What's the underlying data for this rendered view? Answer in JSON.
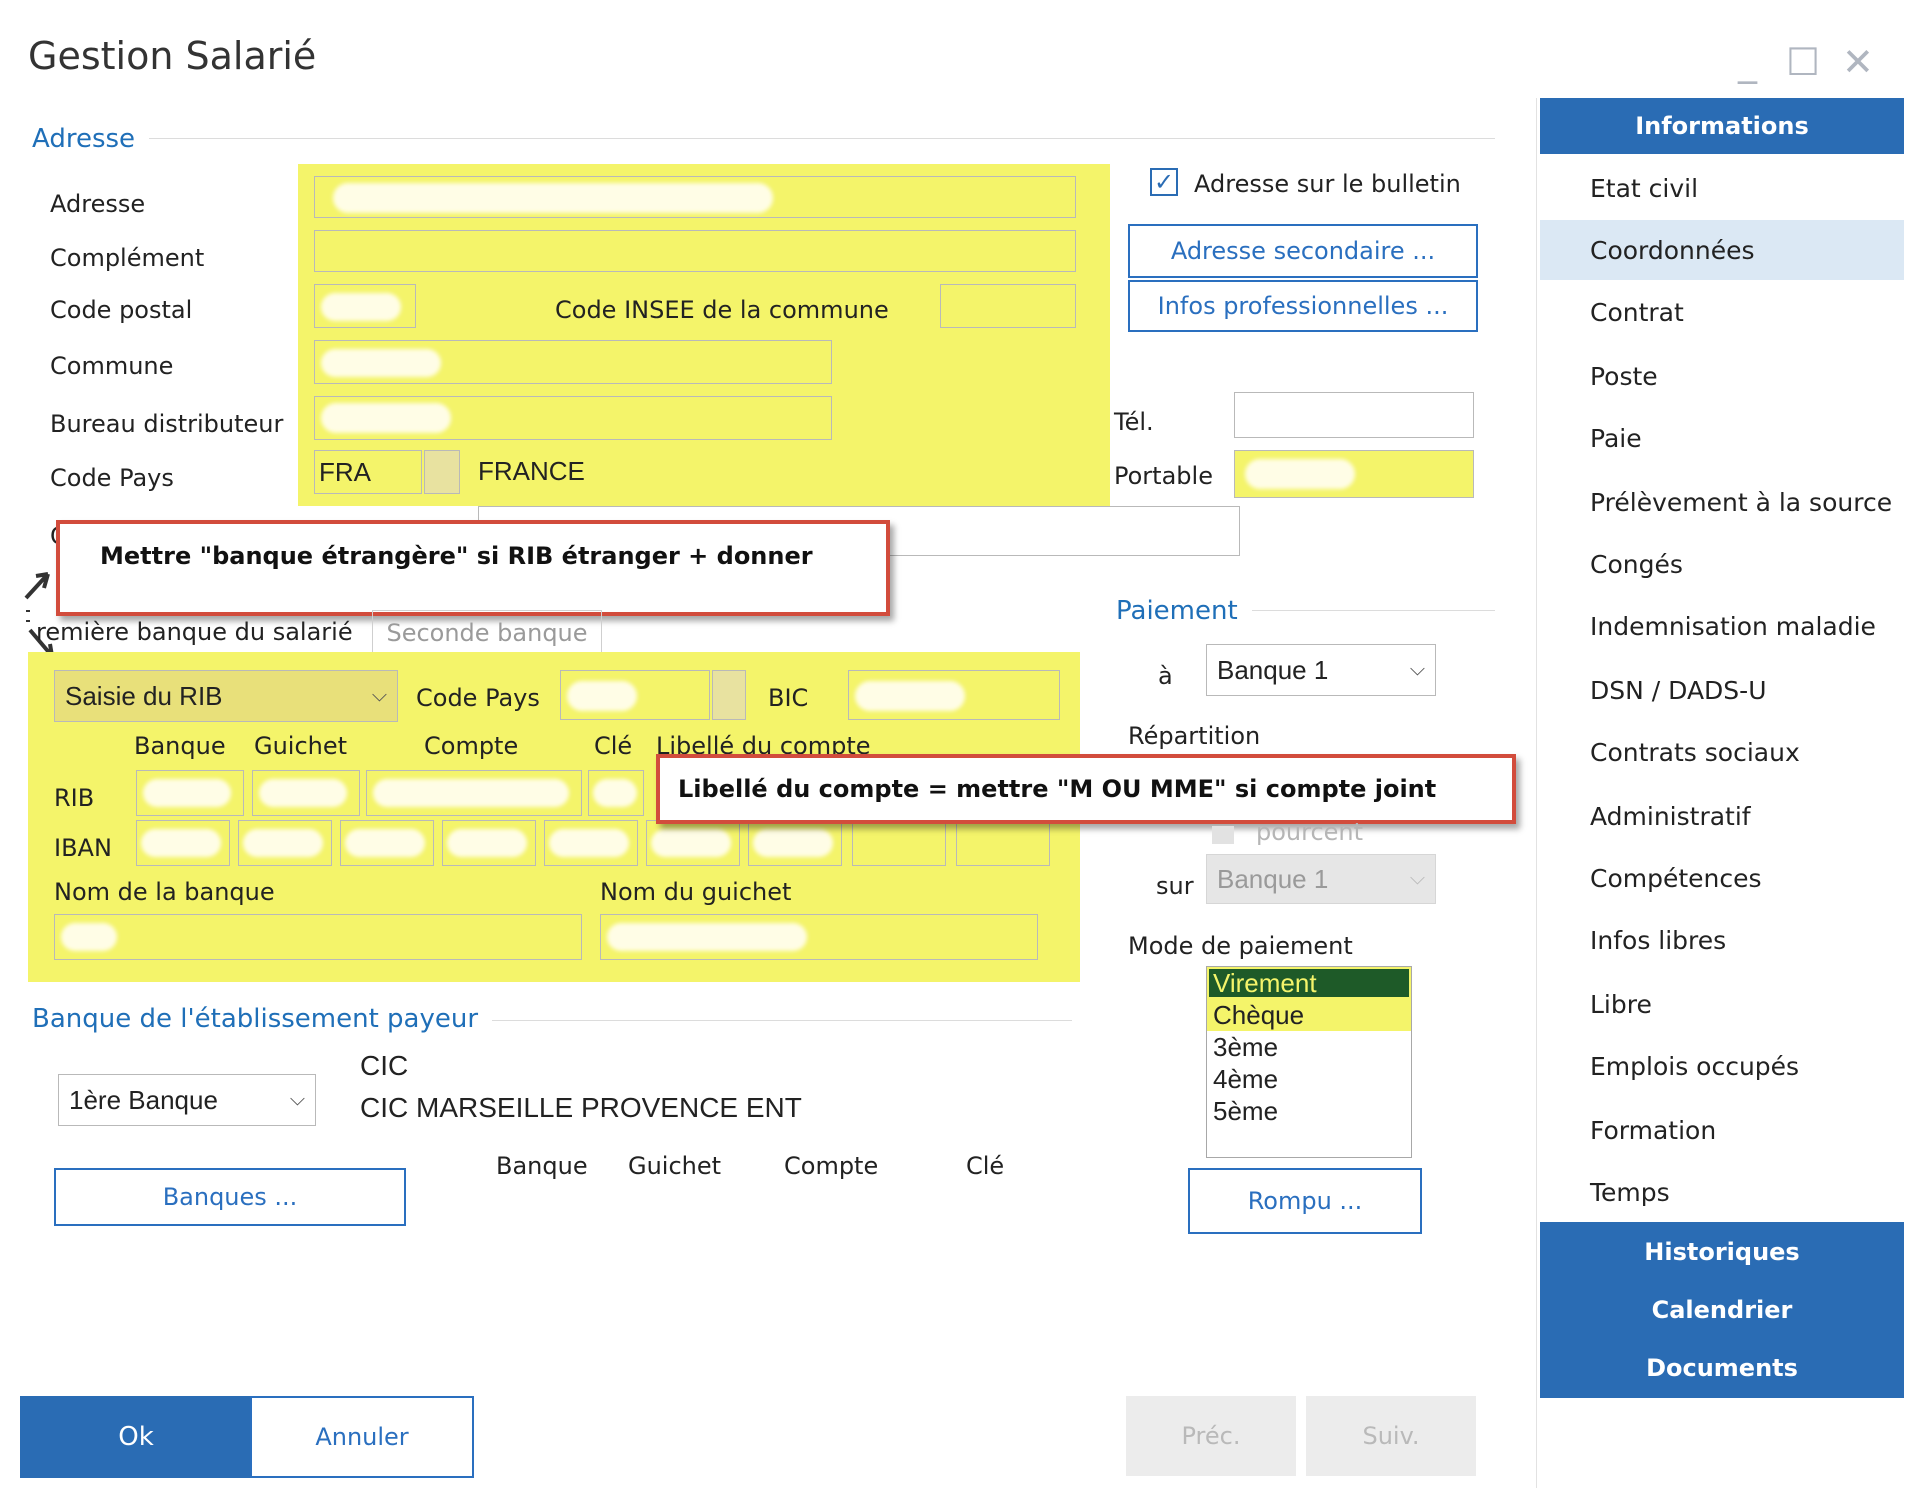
{
  "window": {
    "title": "Gestion Salarié",
    "controls": {
      "minimize": "_",
      "maximize": "☐",
      "close": "✕"
    }
  },
  "address_section": {
    "title": "Adresse",
    "labels": {
      "adresse": "Adresse",
      "complement": "Complément",
      "code_postal": "Code postal",
      "commune": "Commune",
      "bureau": "Bureau distributeur",
      "code_pays": "Code Pays",
      "insee": "Code INSEE de la commune"
    },
    "country_code": "FRA",
    "country_name": "FRANCE",
    "checkbox_label": "Adresse sur le bulletin",
    "checkbox_checked": true,
    "btn_secondary": "Adresse secondaire ...",
    "btn_pro": "Infos professionnelles ...",
    "tel_label": "Tél.",
    "portable_label": "Portable"
  },
  "notes": {
    "note1": "Mettre \"banque étrangère\" si RIB étranger + donner",
    "note2": "Libellé du compte = mettre \"M OU MME\" si compte joint"
  },
  "bank_section": {
    "tab1": "remière banque du salarié",
    "tab2": "Seconde banque",
    "saisie_select": "Saisie du RIB",
    "code_pays_label": "Code Pays",
    "bic_label": "BIC",
    "columns": {
      "banque": "Banque",
      "guichet": "Guichet",
      "compte": "Compte",
      "cle": "Clé",
      "libelle": "Libellé du compte"
    },
    "rib_label": "RIB",
    "iban_label": "IBAN",
    "nom_banque": "Nom de la banque",
    "nom_guichet": "Nom du guichet"
  },
  "payment_section": {
    "title": "Paiement",
    "a_label": "à",
    "a_value": "Banque 1",
    "repartition_label": "Répartition",
    "pourcent_label": "pourcent",
    "sur_label": "sur",
    "sur_value": "Banque 1",
    "mode_label": "Mode de paiement",
    "modes": [
      "Virement",
      "Chèque",
      "3ème",
      "4ème",
      "5ème"
    ],
    "rompu_button": "Rompu ..."
  },
  "payer_bank_section": {
    "title": "Banque de l'établissement payeur",
    "select_value": "1ère Banque",
    "bank_name": "CIC",
    "bank_branch": "CIC MARSEILLE PROVENCE ENT",
    "col_banque": "Banque",
    "col_guichet": "Guichet",
    "col_compte": "Compte",
    "col_cle": "Clé",
    "banques_button": "Banques ..."
  },
  "footer": {
    "ok": "Ok",
    "annuler": "Annuler",
    "prec": "Préc.",
    "suiv": "Suiv."
  },
  "sidebar": {
    "informations": "Informations",
    "items": [
      "Etat civil",
      "Coordonnées",
      "Contrat",
      "Poste",
      "Paie",
      "Prélèvement à la source",
      "Congés",
      "Indemnisation maladie",
      "DSN / DADS-U",
      "Contrats sociaux",
      "Administratif",
      "Compétences",
      "Infos libres",
      "Libre",
      "Emplois occupés",
      "Formation",
      "Temps"
    ],
    "selected_index": 1,
    "historiques": "Historiques",
    "calendrier": "Calendrier",
    "documents": "Documents"
  },
  "colors": {
    "accent": "#2a6cb4",
    "highlight_yellow": "#f4f46a",
    "note_border": "#d24c3c",
    "selected_mode_bg": "#1e5a28"
  }
}
